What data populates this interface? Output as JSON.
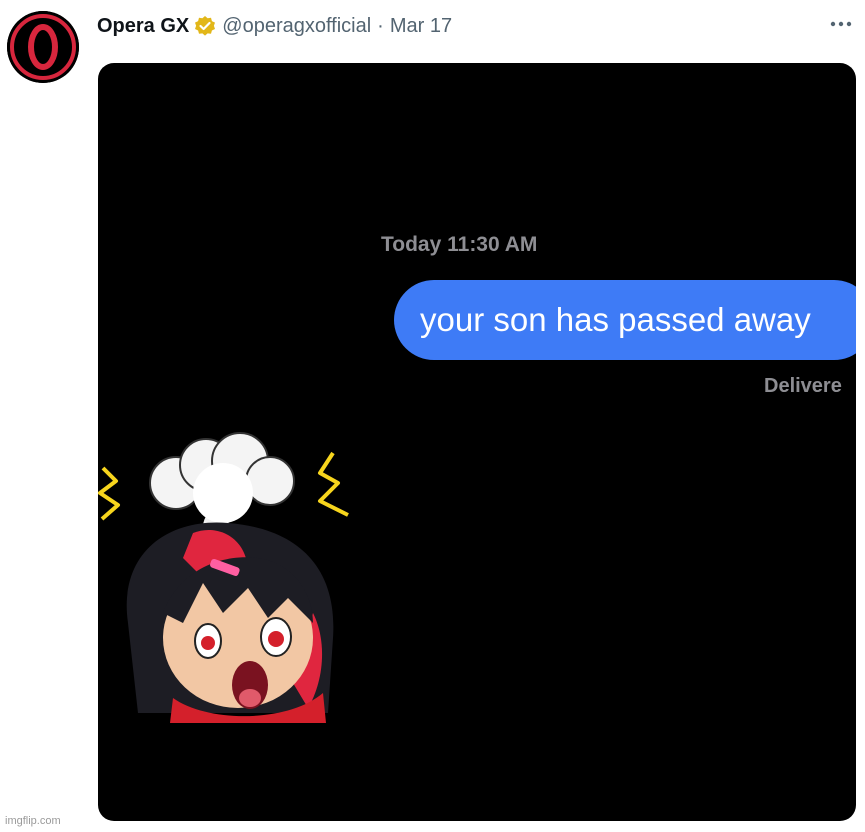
{
  "author": {
    "name": "Opera GX",
    "handle": "@operagxofficial",
    "separator": "·",
    "date": "Mar 17",
    "avatar_icon": "opera-gx-logo-icon",
    "verified_icon": "verified-badge-icon",
    "verified_color": "#e2b719"
  },
  "more_icon": "more-options-icon",
  "media": {
    "timestamp": "Today 11:30 AM",
    "message": "your son has passed away",
    "status": "Delivere",
    "bubble_color": "#3e7bf6",
    "background": "#000000",
    "sticker": "shocked-anime-girl-sticker"
  },
  "watermark": "imgflip.com"
}
